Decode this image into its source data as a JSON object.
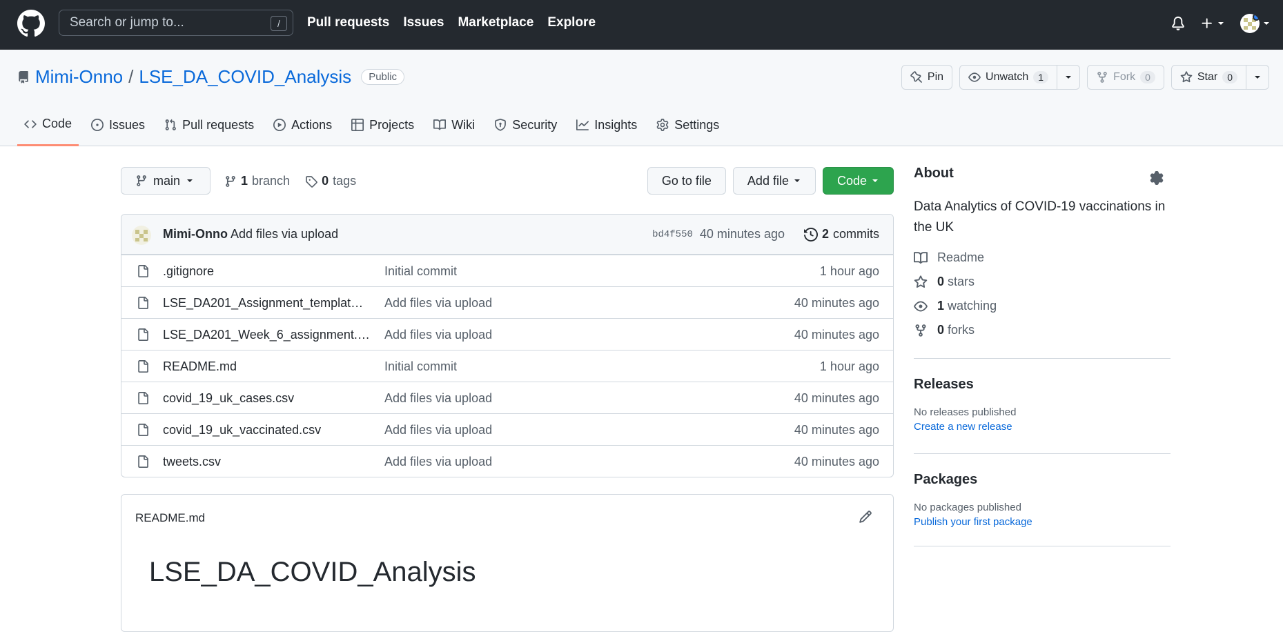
{
  "header": {
    "search_placeholder": "Search or jump to...",
    "search_shortcut": "/",
    "nav": [
      "Pull requests",
      "Issues",
      "Marketplace",
      "Explore"
    ],
    "colors": {
      "bg": "#24292f",
      "notification_dot": "#2f81f7"
    }
  },
  "repo": {
    "owner": "Mimi-Onno",
    "separator": "/",
    "name": "LSE_DA_COVID_Analysis",
    "visibility": "Public",
    "actions": {
      "pin": "Pin",
      "unwatch": "Unwatch",
      "unwatch_count": "1",
      "fork": "Fork",
      "fork_count": "0",
      "star": "Star",
      "star_count": "0"
    },
    "tabs": [
      {
        "label": "Code",
        "icon": "code-icon",
        "active": true
      },
      {
        "label": "Issues",
        "icon": "issue-icon"
      },
      {
        "label": "Pull requests",
        "icon": "pull-request-icon"
      },
      {
        "label": "Actions",
        "icon": "play-icon"
      },
      {
        "label": "Projects",
        "icon": "table-icon"
      },
      {
        "label": "Wiki",
        "icon": "book-icon"
      },
      {
        "label": "Security",
        "icon": "shield-icon"
      },
      {
        "label": "Insights",
        "icon": "graph-icon"
      },
      {
        "label": "Settings",
        "icon": "gear-icon"
      }
    ]
  },
  "toolbar": {
    "branch": "main",
    "branch_count": "1",
    "branch_label": "branch",
    "tag_count": "0",
    "tag_label": "tags",
    "go_to_file": "Go to file",
    "add_file": "Add file",
    "code": "Code",
    "code_color": "#2da44e"
  },
  "commit": {
    "author": "Mimi-Onno",
    "message": "Add files via upload",
    "sha": "bd4f550",
    "time": "40 minutes ago",
    "commit_count": "2",
    "commit_label": "commits"
  },
  "files": [
    {
      "name": ".gitignore",
      "message": "Initial commit",
      "time": "1 hour ago"
    },
    {
      "name": "LSE_DA201_Assignment_template.ipy...",
      "message": "Add files via upload",
      "time": "40 minutes ago"
    },
    {
      "name": "LSE_DA201_Week_6_assignment.ipynb",
      "message": "Add files via upload",
      "time": "40 minutes ago"
    },
    {
      "name": "README.md",
      "message": "Initial commit",
      "time": "1 hour ago"
    },
    {
      "name": "covid_19_uk_cases.csv",
      "message": "Add files via upload",
      "time": "40 minutes ago"
    },
    {
      "name": "covid_19_uk_vaccinated.csv",
      "message": "Add files via upload",
      "time": "40 minutes ago"
    },
    {
      "name": "tweets.csv",
      "message": "Add files via upload",
      "time": "40 minutes ago"
    }
  ],
  "readme": {
    "filename": "README.md",
    "title": "LSE_DA_COVID_Analysis"
  },
  "about": {
    "heading": "About",
    "description": "Data Analytics of COVID-19 vaccinations in the UK",
    "readme": "Readme",
    "stars_count": "0",
    "stars_label": "stars",
    "watching_count": "1",
    "watching_label": "watching",
    "forks_count": "0",
    "forks_label": "forks"
  },
  "releases": {
    "heading": "Releases",
    "empty": "No releases published",
    "link": "Create a new release"
  },
  "packages": {
    "heading": "Packages",
    "empty": "No packages published",
    "link": "Publish your first package"
  }
}
